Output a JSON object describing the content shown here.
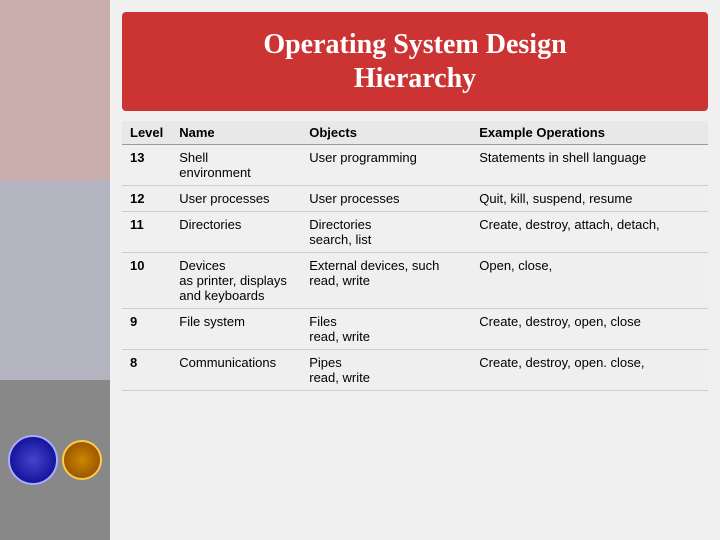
{
  "title": {
    "line1": "Operating System Design",
    "line2": "Hierarchy"
  },
  "table": {
    "headers": [
      "Level",
      "Name",
      "Objects",
      "Example Operations"
    ],
    "rows": [
      {
        "level": "13",
        "name": "Shell\nenvironment",
        "objects": "User programming",
        "example": "Statements in shell language"
      },
      {
        "level": "12",
        "name": "User processes",
        "objects": "User processes",
        "example": "Quit, kill, suspend, resume"
      },
      {
        "level": "11",
        "name": "Directories",
        "objects": "Directories\nsearch, list",
        "example": "Create, destroy, attach, detach,"
      },
      {
        "level": "10",
        "name": "Devices\nas printer, displays\nand keyboards",
        "objects": "External devices, such\nread, write",
        "example": "Open, close,"
      },
      {
        "level": "9",
        "name": "File system",
        "objects": "Files\nread, write",
        "example": "Create, destroy, open, close"
      },
      {
        "level": "8",
        "name": "Communications",
        "objects": "Pipes\nread, write",
        "example": "Create, destroy, open. close,"
      }
    ]
  }
}
